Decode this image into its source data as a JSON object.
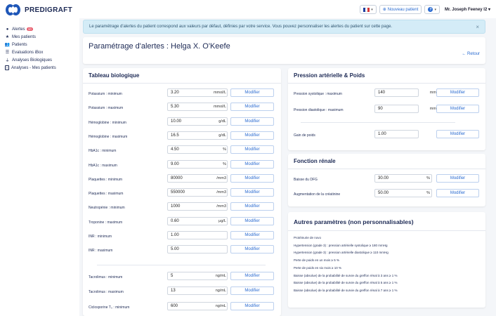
{
  "brand": {
    "name": "PREDIGRAFT"
  },
  "topbar": {
    "flag_colors": [
      "#1f3fa0",
      "#ffffff",
      "#d63838"
    ],
    "new_patient_label": "Nouveau patient",
    "help_label": "?",
    "user_name": "Mr. Joseph Feeney I2"
  },
  "sidebar": {
    "items": [
      {
        "label": "Alertes",
        "badge": "10",
        "icon": "alert-circle-icon"
      },
      {
        "label": "Mes patients",
        "icon": "star-icon"
      },
      {
        "label": "Patients",
        "icon": "users-icon"
      },
      {
        "label": "Evaluations iBox",
        "icon": "list-icon"
      },
      {
        "label": "Analyses Biologiques",
        "icon": "test-tube-icon"
      },
      {
        "label": "Analyses - Mes patients",
        "icon": "document-icon"
      }
    ]
  },
  "alert": {
    "text": "Le paramétrage d'alertes du patient correspond aux valeurs par défaut, définies par votre service. Vous pouvez personnaliser les alertes du patient sur cette page.",
    "close": "×"
  },
  "header": {
    "title": "Paramétrage d'alertes : Helga X. O'Keefe",
    "back_label": "← Retour"
  },
  "bio": {
    "title": "Tableau biologique",
    "button_label": "Modifier",
    "rows": [
      {
        "label": "Potassium : minimum",
        "value": "3.20",
        "unit": "mmol/L"
      },
      {
        "label": "Potassium : maximum",
        "value": "5.30",
        "unit": "mmol/L"
      },
      {
        "label": "Hémoglobine : minimum",
        "value": "10.00",
        "unit": "g/dL"
      },
      {
        "label": "Hémoglobine : maximum",
        "value": "16.5",
        "unit": "g/dL"
      },
      {
        "label": "HbA1c : minimum",
        "value": "4.50",
        "unit": "%"
      },
      {
        "label": "HbA1c : maximum",
        "value": "9.00",
        "unit": "%"
      },
      {
        "label": "Plaquettes : minimum",
        "value": "80000",
        "unit": "/mm3"
      },
      {
        "label": "Plaquettes : maximum",
        "value": "550000",
        "unit": "/mm3"
      },
      {
        "label": "Neutropénie : minimum",
        "value": "1000",
        "unit": "/mm3"
      },
      {
        "label": "Troponine : maximum",
        "value": "0.60",
        "unit": "µg/L"
      },
      {
        "label": "INR : minimum",
        "value": "1.00",
        "unit": ""
      },
      {
        "label": "INR : maximum",
        "value": "5.00",
        "unit": ""
      },
      {
        "label": "Tacrolimus : minimum",
        "value": "5",
        "unit": "ng/mL"
      },
      {
        "label": "Tacrolimus : maximum",
        "value": "13",
        "unit": "ng/mL"
      },
      {
        "label": "Ciclosporine T₀ : minimum",
        "value": "600",
        "unit": "ng/mL"
      }
    ]
  },
  "pa": {
    "title": "Pression artérielle & Poids",
    "button_label": "Modifier",
    "rows": [
      {
        "label": "Pression systolique : maximum",
        "value": "140",
        "unit": "mmHg"
      },
      {
        "label": "Pression diastolique : maximum",
        "value": "90",
        "unit": "mmHg"
      },
      {
        "label": "Gain de poids",
        "value": "1.00",
        "unit": "kg"
      }
    ]
  },
  "renal": {
    "title": "Fonction rénale",
    "button_label": "Modifier",
    "rows": [
      {
        "label": "Baisse du DFG",
        "value": "30.00",
        "unit": "%"
      },
      {
        "label": "Augmentation de la créatinine",
        "value": "50.00",
        "unit": "%"
      }
    ]
  },
  "other": {
    "title": "Autres paramètres (non personnalisables)",
    "items": [
      "Protéinurie de novo",
      "Hypertension (grade 3) : pression artérielle systolique ≥ 180 mmHg",
      "Hypertension (grade 3) : pression artérielle diastolique ≥ 110 mmHg",
      "Perte de poids en un mois ≥ 5 %",
      "Perte de poids en six mois ≥ 10 %",
      "Baisse (absolue) de la probabilité de survie du greffon rénal à 3 ans ≥ 1 %",
      "Baisse (absolue) de la probabilité de survie du greffon rénal à 5 ans ≥ 1 %",
      "Baisse (absolue) de la probabilité de survie du greffon rénal à 7 ans ≥ 1 %"
    ]
  }
}
